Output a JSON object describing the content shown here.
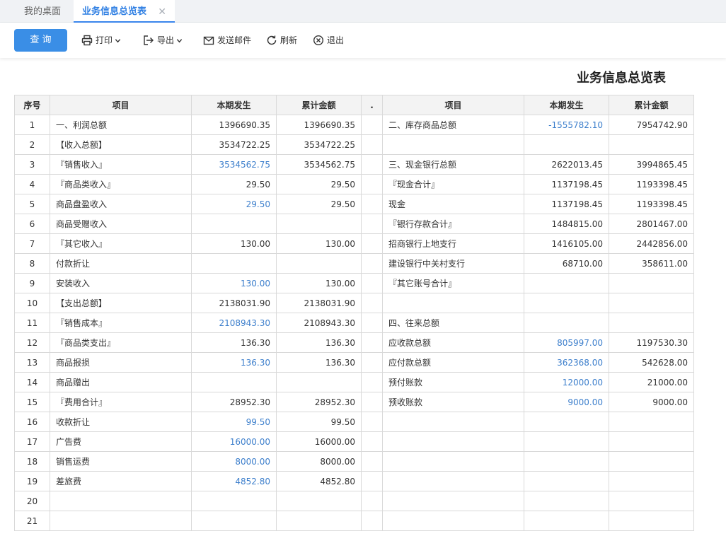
{
  "tabs": [
    {
      "label": "我的桌面",
      "active": false
    },
    {
      "label": "业务信息总览表",
      "active": true
    }
  ],
  "toolbar": {
    "query": "查 询",
    "print": "打印",
    "export": "导出",
    "mail": "发送邮件",
    "refresh": "刷新",
    "exit": "退出"
  },
  "report": {
    "title": "业务信息总览表",
    "headers": [
      "序号",
      "项目",
      "本期发生",
      "累计金额",
      ".",
      "项目",
      "本期发生",
      "累计金额"
    ],
    "rows": [
      {
        "no": "1",
        "item": "一、利润总额",
        "cur": "1396690.35",
        "cur_link": false,
        "acc": "1396690.35",
        "item2": "二、库存商品总额",
        "cur2": "-1555782.10",
        "cur2_link": true,
        "acc2": "7954742.90"
      },
      {
        "no": "2",
        "item": "【收入总额】",
        "cur": "3534722.25",
        "cur_link": false,
        "acc": "3534722.25",
        "item2": "",
        "cur2": "",
        "cur2_link": false,
        "acc2": ""
      },
      {
        "no": "3",
        "item": "『销售收入』",
        "cur": "3534562.75",
        "cur_link": true,
        "acc": "3534562.75",
        "item2": "三、现金银行总额",
        "cur2": "2622013.45",
        "cur2_link": false,
        "acc2": "3994865.45"
      },
      {
        "no": "4",
        "item": "『商品类收入』",
        "cur": "29.50",
        "cur_link": false,
        "acc": "29.50",
        "item2": "『现金合计』",
        "cur2": "1137198.45",
        "cur2_link": false,
        "acc2": "1193398.45"
      },
      {
        "no": "5",
        "item": "商品盘盈收入",
        "cur": "29.50",
        "cur_link": true,
        "acc": "29.50",
        "item2": "现金",
        "cur2": "1137198.45",
        "cur2_link": false,
        "acc2": "1193398.45"
      },
      {
        "no": "6",
        "item": "商品受赠收入",
        "cur": "",
        "cur_link": false,
        "acc": "",
        "item2": "『银行存款合计』",
        "cur2": "1484815.00",
        "cur2_link": false,
        "acc2": "2801467.00"
      },
      {
        "no": "7",
        "item": "『其它收入』",
        "cur": "130.00",
        "cur_link": false,
        "acc": "130.00",
        "item2": "招商银行上地支行",
        "cur2": "1416105.00",
        "cur2_link": false,
        "acc2": "2442856.00"
      },
      {
        "no": "8",
        "item": "付款折让",
        "cur": "",
        "cur_link": false,
        "acc": "",
        "item2": "建设银行中关村支行",
        "cur2": "68710.00",
        "cur2_link": false,
        "acc2": "358611.00"
      },
      {
        "no": "9",
        "item": "安装收入",
        "cur": "130.00",
        "cur_link": true,
        "acc": "130.00",
        "item2": "『其它账号合计』",
        "cur2": "",
        "cur2_link": false,
        "acc2": ""
      },
      {
        "no": "10",
        "item": "【支出总额】",
        "cur": "2138031.90",
        "cur_link": false,
        "acc": "2138031.90",
        "item2": "",
        "cur2": "",
        "cur2_link": false,
        "acc2": ""
      },
      {
        "no": "11",
        "item": "『销售成本』",
        "cur": "2108943.30",
        "cur_link": true,
        "acc": "2108943.30",
        "item2": "四、往来总额",
        "cur2": "",
        "cur2_link": false,
        "acc2": ""
      },
      {
        "no": "12",
        "item": "『商品类支出』",
        "cur": "136.30",
        "cur_link": false,
        "acc": "136.30",
        "item2": "应收款总额",
        "cur2": "805997.00",
        "cur2_link": true,
        "acc2": "1197530.30"
      },
      {
        "no": "13",
        "item": "商品报损",
        "cur": "136.30",
        "cur_link": true,
        "acc": "136.30",
        "item2": "应付款总额",
        "cur2": "362368.00",
        "cur2_link": true,
        "acc2": "542628.00"
      },
      {
        "no": "14",
        "item": "商品赠出",
        "cur": "",
        "cur_link": false,
        "acc": "",
        "item2": "预付账款",
        "cur2": "12000.00",
        "cur2_link": true,
        "acc2": "21000.00"
      },
      {
        "no": "15",
        "item": "『费用合计』",
        "cur": "28952.30",
        "cur_link": false,
        "acc": "28952.30",
        "item2": "预收账款",
        "cur2": "9000.00",
        "cur2_link": true,
        "acc2": "9000.00"
      },
      {
        "no": "16",
        "item": "收款折让",
        "cur": "99.50",
        "cur_link": true,
        "acc": "99.50",
        "item2": "",
        "cur2": "",
        "cur2_link": false,
        "acc2": ""
      },
      {
        "no": "17",
        "item": "广告费",
        "cur": "16000.00",
        "cur_link": true,
        "acc": "16000.00",
        "item2": "",
        "cur2": "",
        "cur2_link": false,
        "acc2": ""
      },
      {
        "no": "18",
        "item": "销售运费",
        "cur": "8000.00",
        "cur_link": true,
        "acc": "8000.00",
        "item2": "",
        "cur2": "",
        "cur2_link": false,
        "acc2": ""
      },
      {
        "no": "19",
        "item": "差旅费",
        "cur": "4852.80",
        "cur_link": true,
        "acc": "4852.80",
        "item2": "",
        "cur2": "",
        "cur2_link": false,
        "acc2": ""
      },
      {
        "no": "20",
        "item": "",
        "cur": "",
        "cur_link": false,
        "acc": "",
        "item2": "",
        "cur2": "",
        "cur2_link": false,
        "acc2": ""
      },
      {
        "no": "21",
        "item": "",
        "cur": "",
        "cur_link": false,
        "acc": "",
        "item2": "",
        "cur2": "",
        "cur2_link": false,
        "acc2": ""
      }
    ]
  },
  "colors": {
    "accent": "#3a8ee6",
    "link_value": "#3d7fcc",
    "active_tab": "#2f7fe3"
  },
  "icons": [
    "printer-icon",
    "export-icon",
    "mail-icon",
    "refresh-icon",
    "exit-icon",
    "close-icon",
    "chevron-down-icon"
  ]
}
